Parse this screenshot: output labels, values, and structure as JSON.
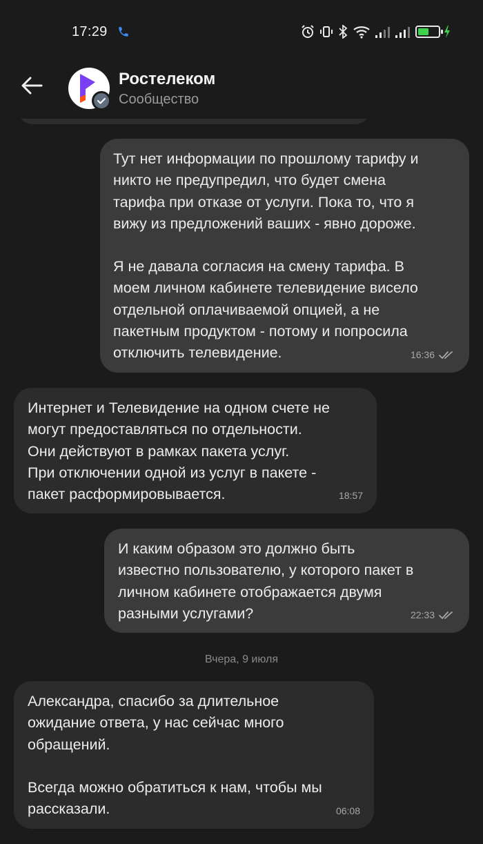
{
  "status_bar": {
    "time": "17:29"
  },
  "header": {
    "title": "Ростелеком",
    "subtitle": "Сообщество"
  },
  "messages": [
    {
      "direction": "outgoing",
      "paragraphs": [
        "Тут нет информации по прошлому тарифу и\nникто не предупредил, что будет смена\nтарифа при отказе от услуги. Пока то, что я\nвижу из предложений ваших - явно дороже.",
        "Я не давала согласия на смену тарифа. В\nмоем личном кабинете телевидение висело\nотдельной оплачиваемой опцией, а не\nпакетным продуктом - потому и попросила\nотключить телевидение."
      ],
      "time": "16:36"
    },
    {
      "direction": "incoming",
      "paragraphs": [
        "Интернет и Телевидение на одном счете не\nмогут предоставляться по отдельности.\nОни действуют в рамках пакета услуг.\nПри отключении одной из услуг в пакете -\nпакет расформировывается."
      ],
      "time": "18:57"
    },
    {
      "direction": "outgoing",
      "paragraphs": [
        "И каким образом это должно быть\nизвестно пользователю, у которого пакет в\nличном кабинете отображается двумя\nразными услугами?"
      ],
      "time": "22:33"
    },
    {
      "direction": "incoming",
      "paragraphs": [
        "Александра, спасибо за длительное\nожидание ответа, у нас сейчас много\nобращений.",
        "Всегда можно обратиться к нам, чтобы мы\nрассказали."
      ],
      "time": "06:08"
    }
  ],
  "date_separator": "Вчера, 9 июля",
  "colors": {
    "background": "#1b1b1b",
    "outgoing_bubble": "#3b3b3b",
    "incoming_bubble": "#2c2c2c",
    "brand": "#7b3ff2",
    "brand_accent": "#ff4f12"
  }
}
